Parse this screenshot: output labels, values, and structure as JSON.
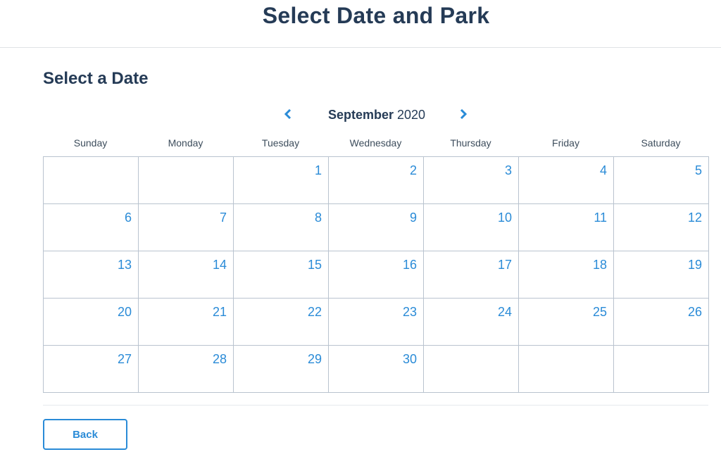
{
  "header": {
    "title": "Select Date and Park"
  },
  "section": {
    "title": "Select a Date"
  },
  "calendar": {
    "month": "September",
    "year": "2020",
    "prev_icon": "chevron-left-icon",
    "next_icon": "chevron-right-icon",
    "weekdays": [
      "Sunday",
      "Monday",
      "Tuesday",
      "Wednesday",
      "Thursday",
      "Friday",
      "Saturday"
    ],
    "weeks": [
      [
        "",
        "",
        "1",
        "2",
        "3",
        "4",
        "5"
      ],
      [
        "6",
        "7",
        "8",
        "9",
        "10",
        "11",
        "12"
      ],
      [
        "13",
        "14",
        "15",
        "16",
        "17",
        "18",
        "19"
      ],
      [
        "20",
        "21",
        "22",
        "23",
        "24",
        "25",
        "26"
      ],
      [
        "27",
        "28",
        "29",
        "30",
        "",
        "",
        ""
      ]
    ]
  },
  "footer": {
    "back_label": "Back"
  },
  "colors": {
    "heading": "#253b56",
    "accent": "#2a8bd7",
    "grid": "#b9c3cf"
  }
}
